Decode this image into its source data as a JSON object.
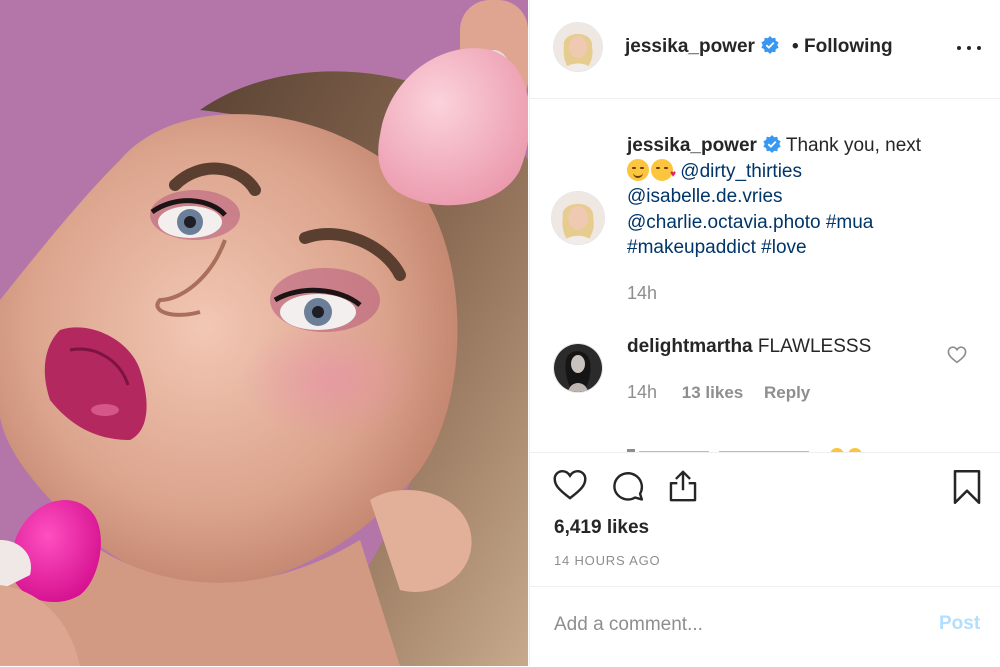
{
  "post": {
    "username": "jessika_power",
    "separator": "•",
    "follow_status": "Following",
    "caption": {
      "username": "jessika_power",
      "text": "Thank you, next",
      "mentions": [
        "@dirty_thirties",
        "@isabelle.de.vries",
        "@charlie.octavia.photo"
      ],
      "hashtags": [
        "#mua",
        "#makeupaddict",
        "#love"
      ],
      "time": "14h"
    },
    "comments": [
      {
        "username": "delightmartha",
        "text": "FLAWLESSS",
        "time": "14h",
        "likes": "13 likes",
        "reply": "Reply"
      }
    ],
    "likes": "6,419 likes",
    "timestamp": "14 HOURS AGO",
    "comment_box": {
      "placeholder": "Add a comment...",
      "post_label": "Post"
    }
  },
  "colors": {
    "verified": "#3897f0",
    "link": "#003569",
    "muted": "#8e8e8e",
    "post_disabled": "#b2dffc",
    "photo_bg": "#b476a9"
  },
  "icons": [
    "verified-badge-icon",
    "more-options-icon",
    "heart-icon",
    "comment-icon",
    "share-icon",
    "bookmark-icon"
  ]
}
